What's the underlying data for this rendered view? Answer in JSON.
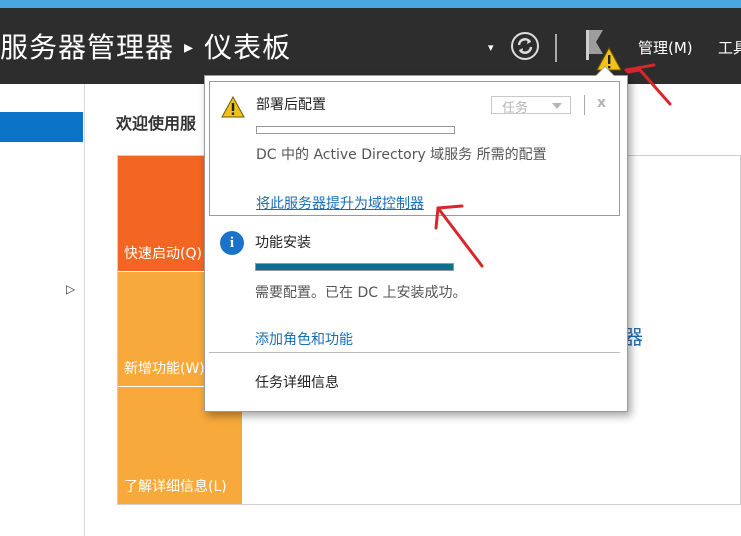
{
  "header": {
    "title": "服务器管理器",
    "separator": "▸",
    "section": "仪表板",
    "dropdown_arrow": "▾",
    "manage_menu": "管理(M)",
    "tools_menu": "工具"
  },
  "main": {
    "welcome": "欢迎使用服",
    "tiles": [
      {
        "label": "快速启动(Q)"
      },
      {
        "label": "新增功能(W)"
      },
      {
        "label": "了解详细信息(L)"
      }
    ],
    "bg_link_fragment": "器"
  },
  "notifications": {
    "tasks": [
      {
        "title": "部署后配置",
        "icon": "warning-icon",
        "progress": 0,
        "description": "DC 中的 Active Directory 域服务 所需的配置",
        "link": "将此服务器提升为域控制器",
        "button": "任务",
        "close": "x"
      },
      {
        "title": "功能安装",
        "icon": "info-icon",
        "info_glyph": "i",
        "progress": 1.0,
        "description": "需要配置。已在 DC 上安装成功。",
        "link": "添加角色和功能"
      }
    ],
    "task_details": "任务详细信息"
  },
  "colors": {
    "header_bg": "#2d2d2d",
    "accent_blue": "#0b74c9",
    "tile_orange": "#f26522",
    "tile_amber": "#f7a93b",
    "progress_teal": "#0e6f8c",
    "link_blue": "#1a6fb8",
    "annotation_red": "#d9262b"
  }
}
